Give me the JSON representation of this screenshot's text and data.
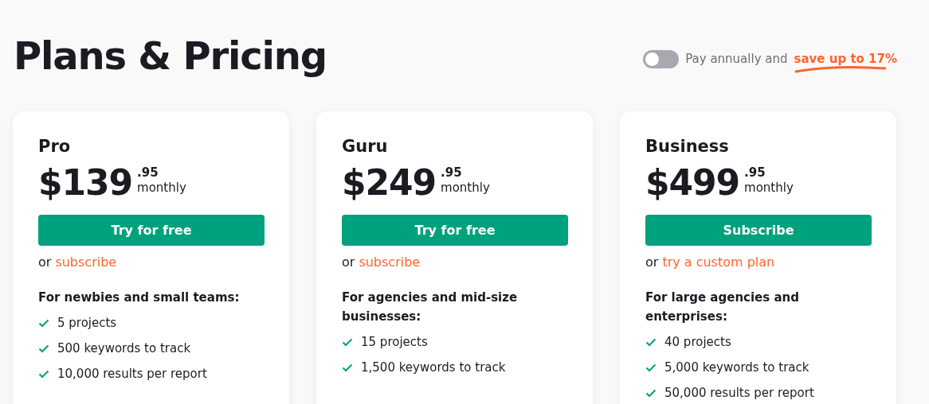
{
  "title": "Plans & Pricing",
  "billing_toggle": {
    "on": false,
    "label": "Pay annually and",
    "highlight": "save up to 17%"
  },
  "plans": [
    {
      "name": "Pro",
      "price": "$139",
      "cents": ".95",
      "period": "monthly",
      "button": "Try for free",
      "or_text": "or",
      "link": "subscribe",
      "description": "For newbies and small teams:",
      "features": [
        "5 projects",
        "500 keywords to track",
        "10,000 results per report"
      ]
    },
    {
      "name": "Guru",
      "price": "$249",
      "cents": ".95",
      "period": "monthly",
      "button": "Try for free",
      "or_text": "or",
      "link": "subscribe",
      "description": "For agencies and mid-size businesses:",
      "features": [
        "15 projects",
        "1,500 keywords to track"
      ]
    },
    {
      "name": "Business",
      "price": "$499",
      "cents": ".95",
      "period": "monthly",
      "button": "Subscribe",
      "or_text": "or",
      "link": "try a custom plan",
      "description": "For large agencies and enterprises:",
      "features": [
        "40 projects",
        "5,000 keywords to track",
        "50,000 results per report"
      ]
    }
  ]
}
